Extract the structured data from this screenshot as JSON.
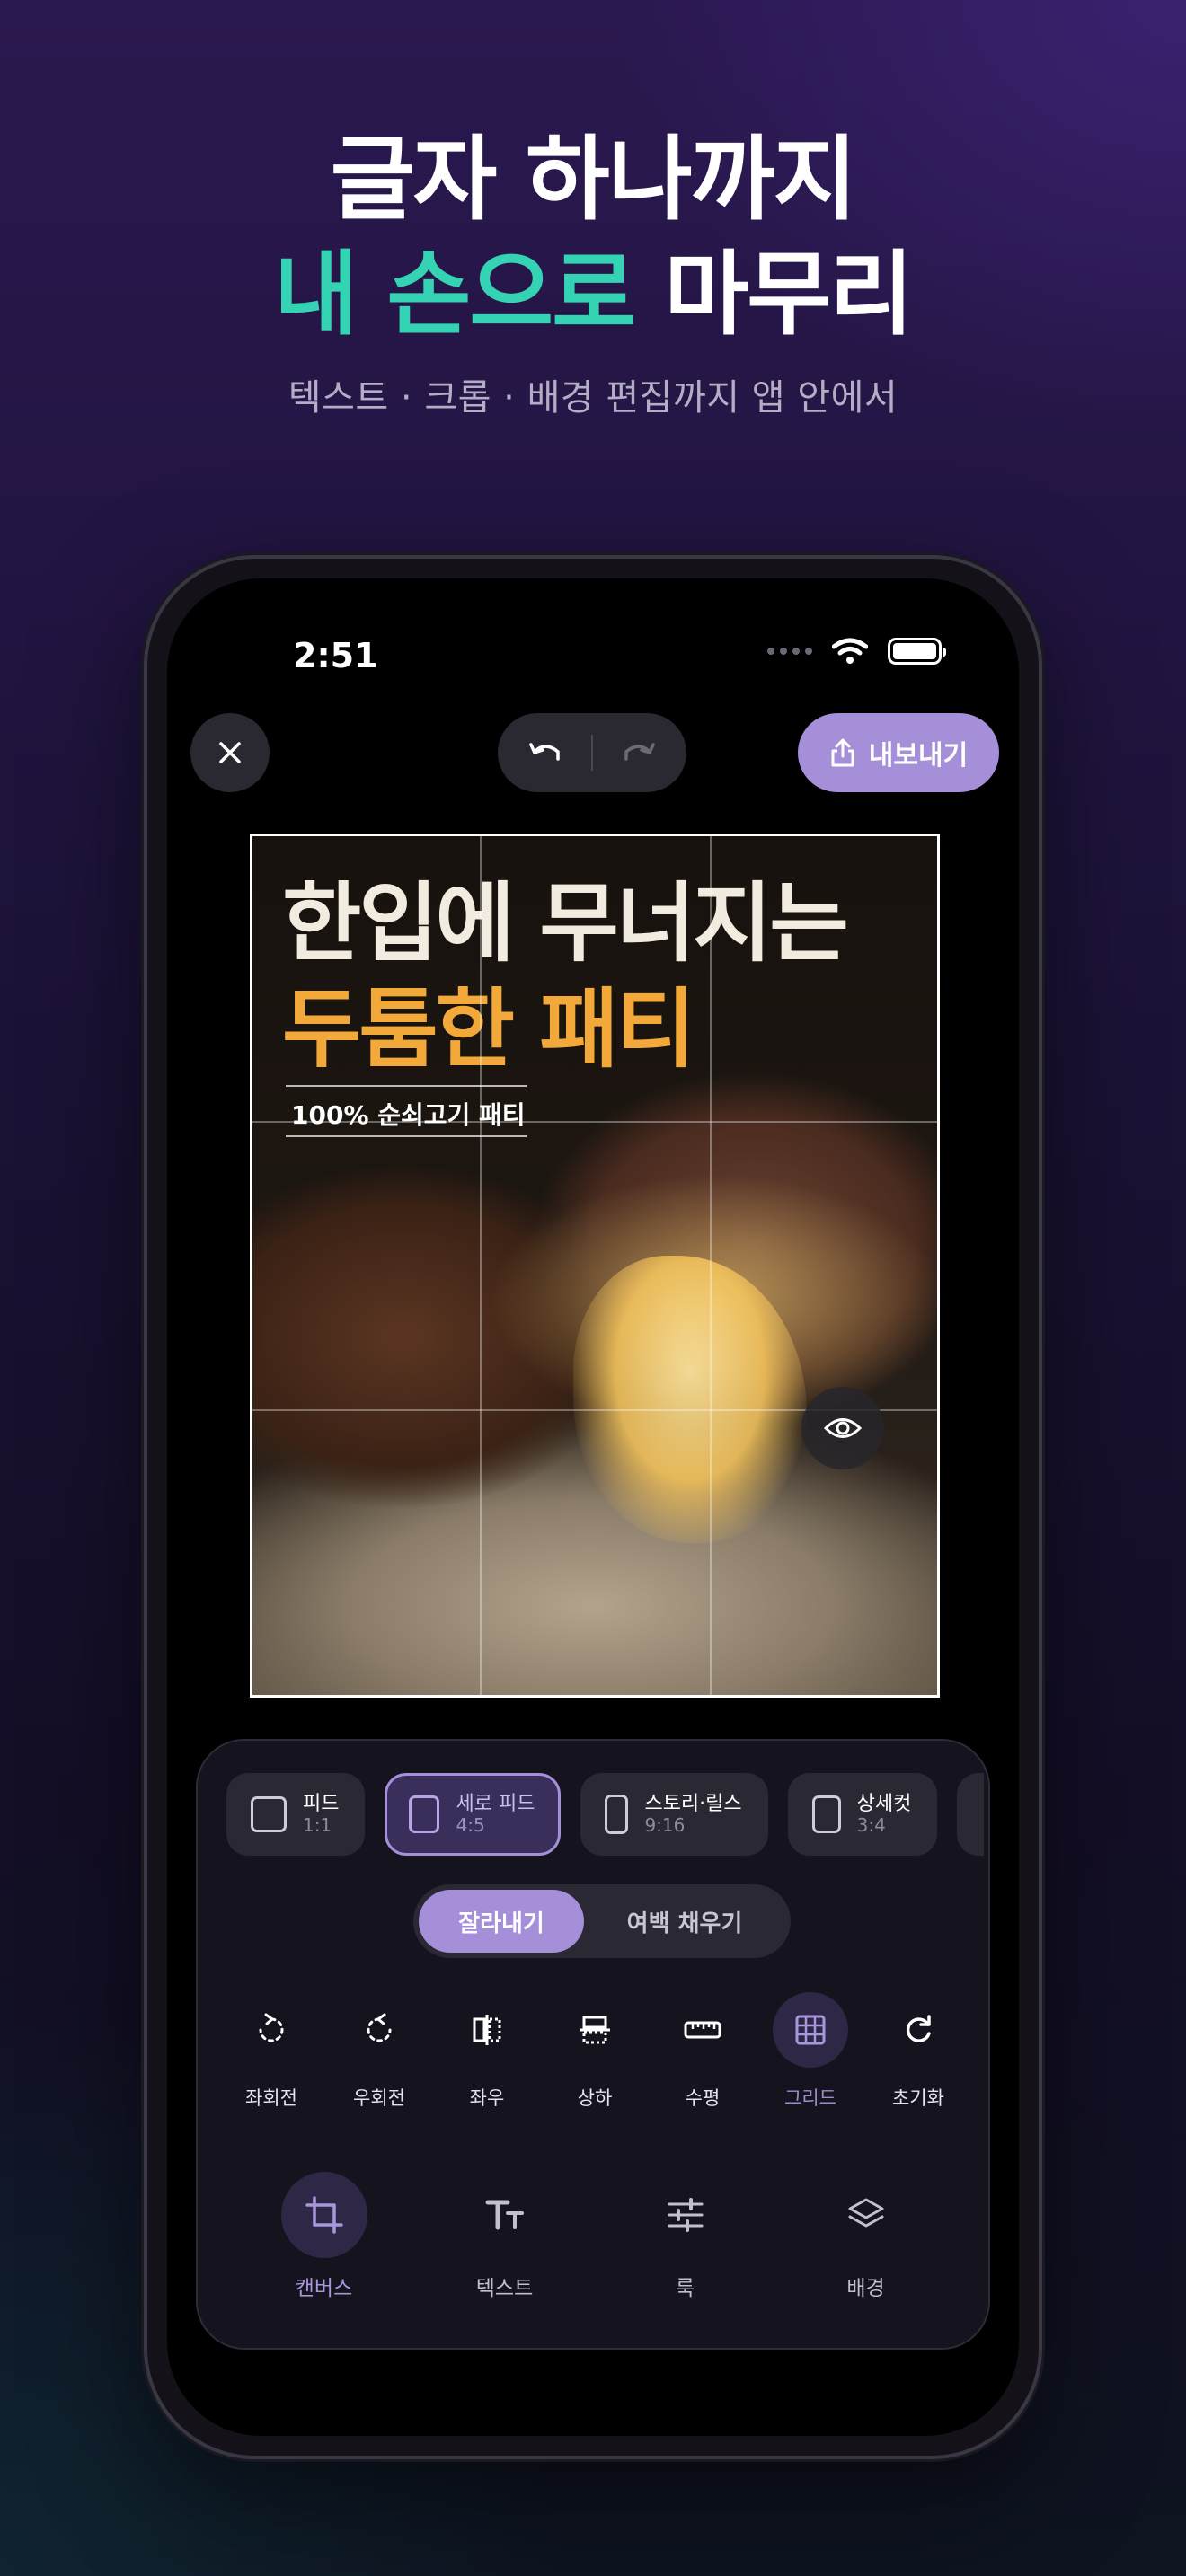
{
  "hero": {
    "line1": "글자 하나까지",
    "line2_accent": "내 손으로",
    "line2_rest": " 마무리",
    "subtitle": "텍스트 · 크롭 · 배경 편집까지 앱 안에서"
  },
  "status_bar": {
    "time": "2:51"
  },
  "toolbar": {
    "export_label": "내보내기"
  },
  "canvas": {
    "poster_title_line1": "한입에 무너지는",
    "poster_title_line2": "두툼한 패티",
    "poster_subtitle": "100% 순쇠고기 패티"
  },
  "ratios": [
    {
      "name": "피드",
      "value": "1:1",
      "selected": false
    },
    {
      "name": "세로 피드",
      "value": "4:5",
      "selected": true
    },
    {
      "name": "스토리·릴스",
      "value": "9:16",
      "selected": false
    },
    {
      "name": "상세컷",
      "value": "3:4",
      "selected": false
    }
  ],
  "fit_modes": {
    "crop": "잘라내기",
    "fill": "여백 채우기",
    "active": "crop"
  },
  "tools": [
    {
      "label": "좌회전",
      "icon": "rotate-left-icon"
    },
    {
      "label": "우회전",
      "icon": "rotate-right-icon"
    },
    {
      "label": "좌우",
      "icon": "flip-horizontal-icon"
    },
    {
      "label": "상하",
      "icon": "flip-vertical-icon"
    },
    {
      "label": "수평",
      "icon": "ruler-icon"
    },
    {
      "label": "그리드",
      "icon": "grid-icon",
      "active": true
    },
    {
      "label": "초기화",
      "icon": "reset-icon"
    }
  ],
  "tabs": [
    {
      "label": "캔버스",
      "icon": "crop-icon",
      "active": true
    },
    {
      "label": "텍스트",
      "icon": "text-icon"
    },
    {
      "label": "룩",
      "icon": "sliders-icon"
    },
    {
      "label": "배경",
      "icon": "layers-icon"
    }
  ],
  "colors": {
    "accent_teal": "#33d3b4",
    "accent_purple": "#a48fd8",
    "poster_orange": "#f2a93a"
  }
}
